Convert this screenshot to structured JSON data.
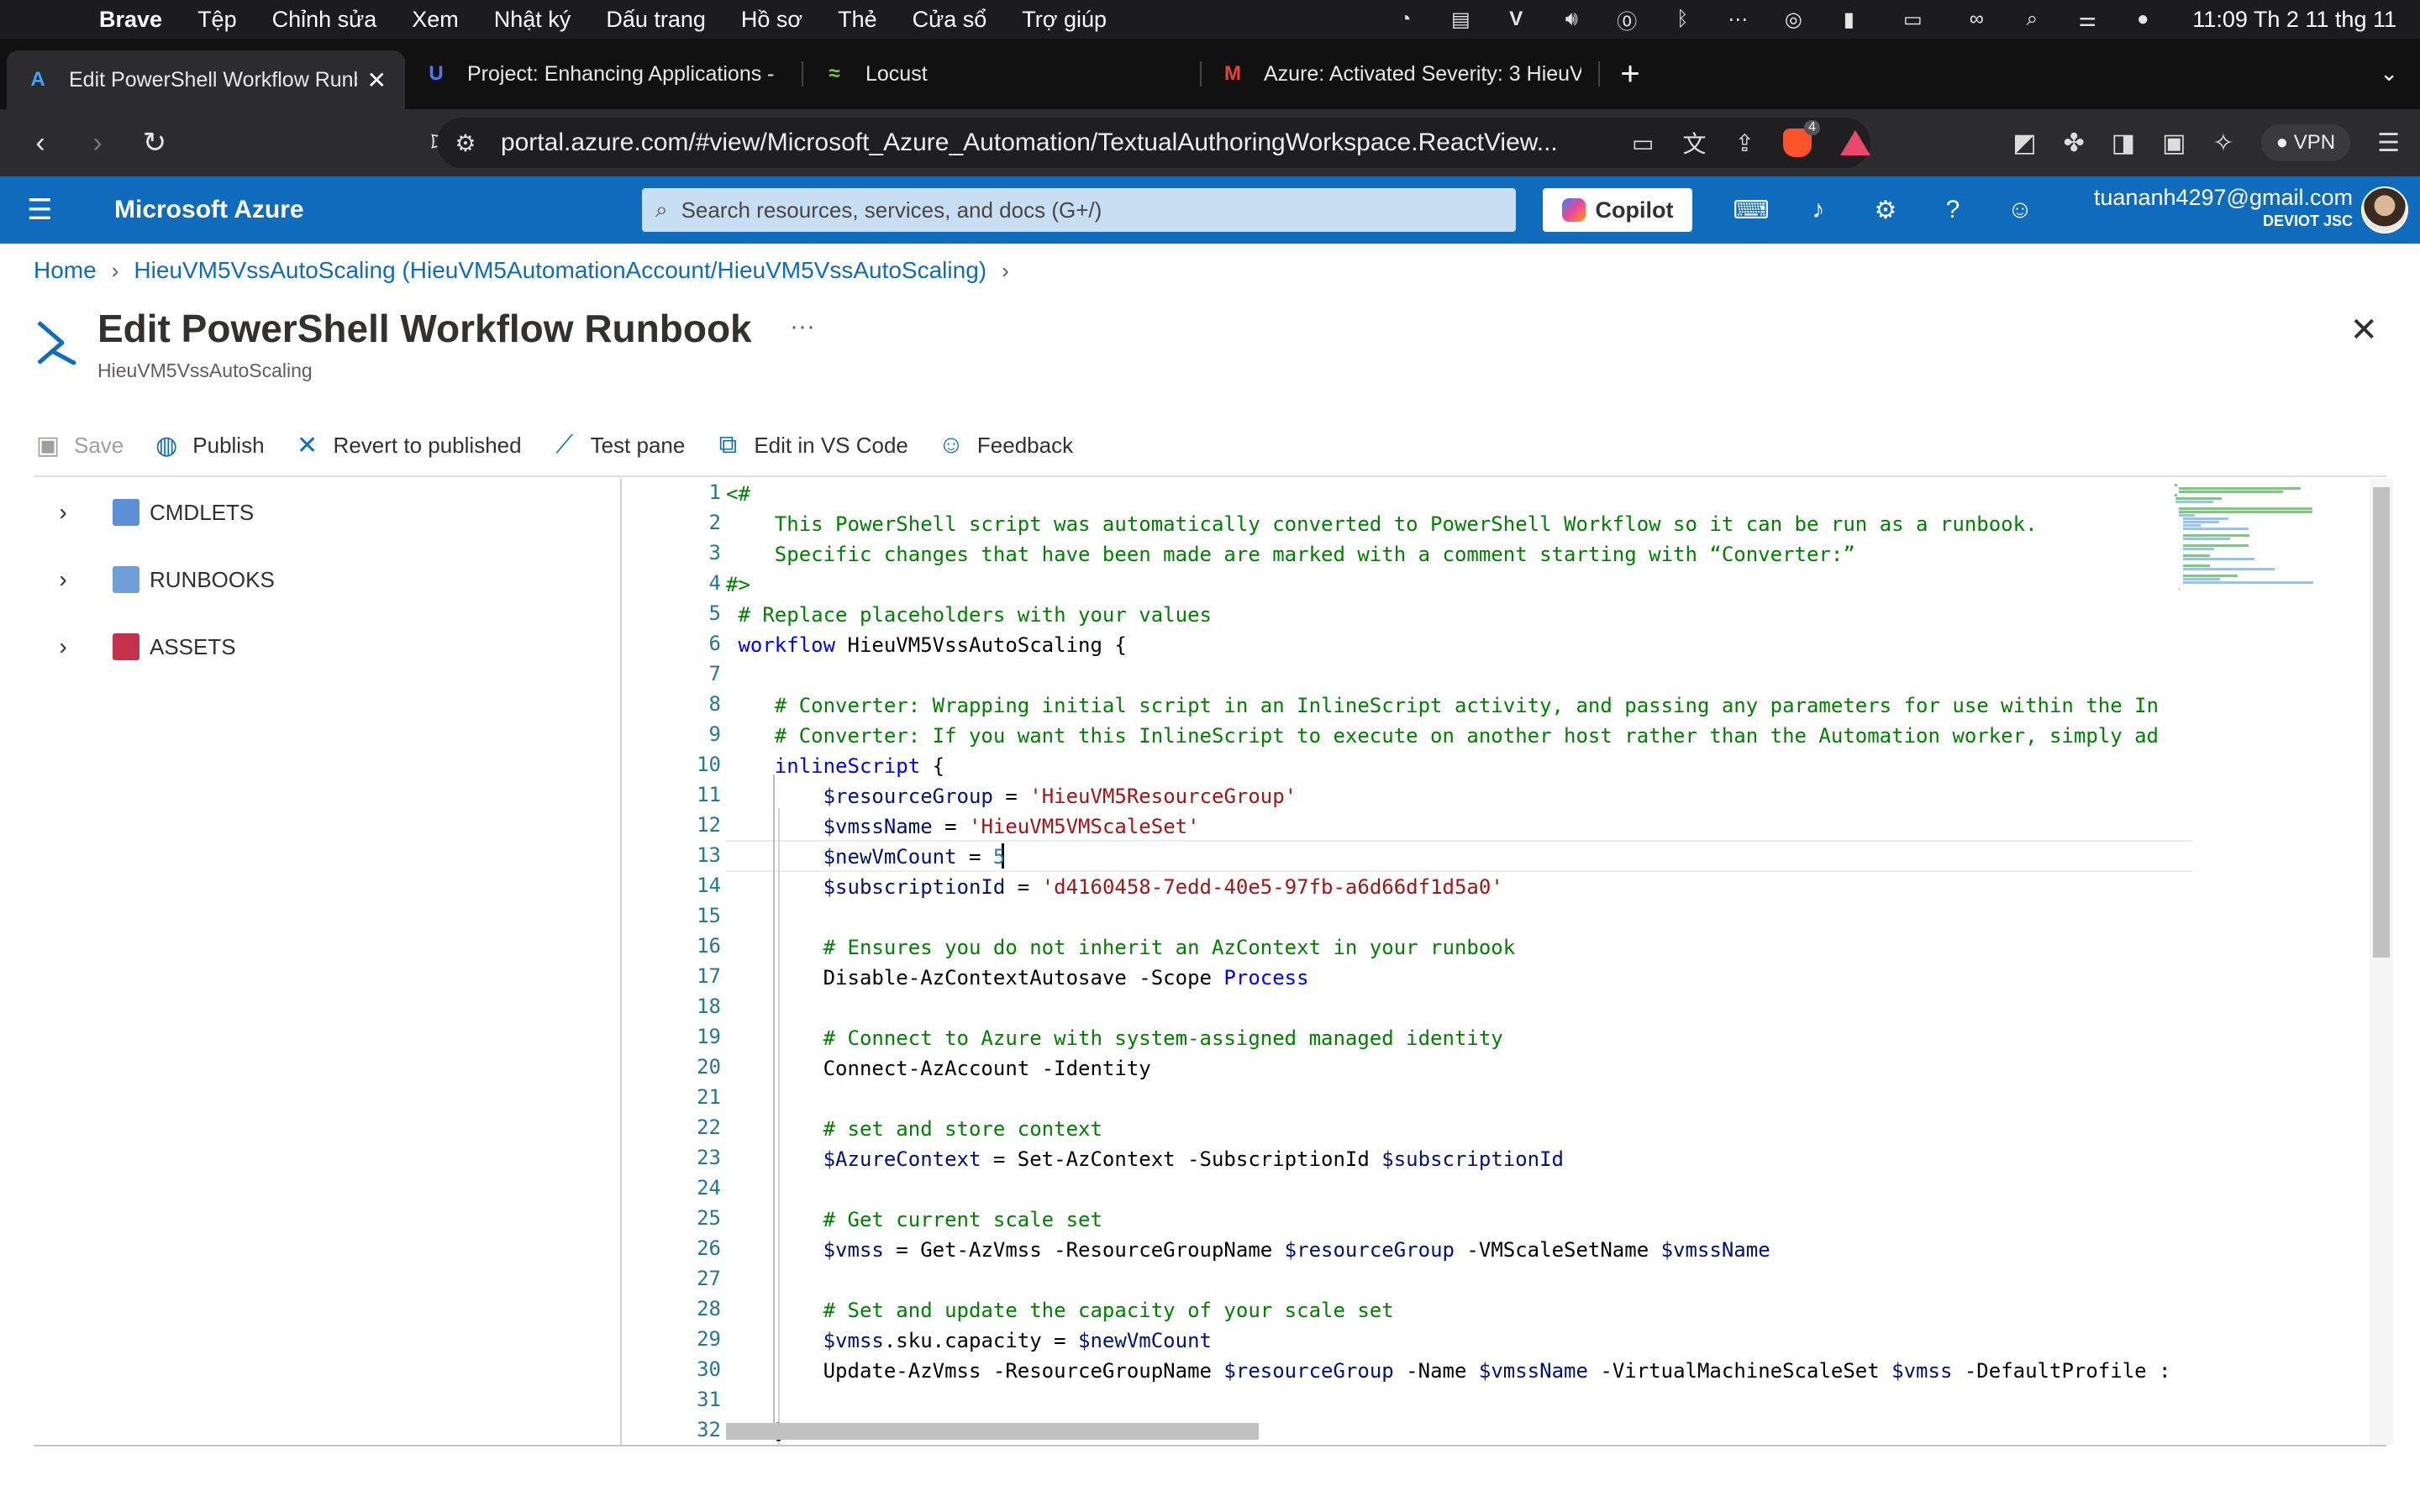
{
  "menubar": {
    "app": "Brave",
    "items": [
      "Tệp",
      "Chỉnh sửa",
      "Xem",
      "Nhật ký",
      "Dấu trang",
      "Hồ sơ",
      "Thẻ",
      "Cửa sổ",
      "Trợ giúp"
    ],
    "clock": "11:09 Th 2 11 thg 11",
    "status_icons": [
      "timer-icon",
      "keyboard-icon",
      "v-icon",
      "volume-icon",
      "accessibility-icon",
      "bluetooth-icon",
      "network-icon",
      "airdrop-icon",
      "battery-status-icon",
      "battery-icon",
      "link-icon",
      "search-icon",
      "control-center-icon",
      "siri-icon"
    ]
  },
  "tabs": [
    {
      "title": "Edit PowerShell Workflow Runbook",
      "icon": "azure-icon",
      "active": true
    },
    {
      "title": "Project: Enhancing Applications -",
      "icon": "udacity-icon",
      "active": false
    },
    {
      "title": "Locust",
      "icon": "locust-icon",
      "active": false
    },
    {
      "title": "Azure: Activated Severity: 3 HieuV",
      "icon": "gmail-icon",
      "active": false
    }
  ],
  "newtab_label": "+",
  "tablist_label": "⌄",
  "addressbar": {
    "url": "portal.azure.com/#view/Microsoft_Azure_Automation/TextualAuthoringWorkspace.ReactView...",
    "brave_badge_count": "4",
    "vpn_label": "VPN"
  },
  "azure": {
    "brand": "Microsoft Azure",
    "search_placeholder": "Search resources, services, and docs (G+/)",
    "copilot_label": "Copilot",
    "account_email": "tuananh4297@gmail.com",
    "account_org": "DEVIOT JSC"
  },
  "breadcrumb": {
    "home": "Home",
    "item": "HieuVM5VssAutoScaling (HieuVM5AutomationAccount/HieuVM5VssAutoScaling)"
  },
  "page": {
    "title": "Edit PowerShell Workflow Runbook",
    "more": "···",
    "subtitle": "HieuVM5VssAutoScaling"
  },
  "commands": {
    "save": "Save",
    "publish": "Publish",
    "revert": "Revert to published",
    "test": "Test pane",
    "vscode": "Edit in VS Code",
    "feedback": "Feedback"
  },
  "tree": {
    "cmdlets": "CMDLETS",
    "runbooks": "RUNBOOKS",
    "assets": "ASSETS"
  },
  "editor": {
    "current_line": 13,
    "lines": [
      "<#",
      "    This PowerShell script was automatically converted to PowerShell Workflow so it can be run as a runbook.",
      "    Specific changes that have been made are marked with a comment starting with “Converter:”",
      "#>",
      " # Replace placeholders with your values",
      " workflow HieuVM5VssAutoScaling {",
      "",
      "    # Converter: Wrapping initial script in an InlineScript activity, and passing any parameters for use within the In",
      "    # Converter: If you want this InlineScript to execute on another host rather than the Automation worker, simply ad",
      "    inlineScript {",
      "        $resourceGroup = 'HieuVM5ResourceGroup'",
      "        $vmssName = 'HieuVM5VMScaleSet'",
      "        $newVmCount = 5",
      "        $subscriptionId = 'd4160458-7edd-40e5-97fb-a6d66df1d5a0'",
      "",
      "        # Ensures you do not inherit an AzContext in your runbook",
      "        Disable-AzContextAutosave -Scope Process",
      "",
      "        # Connect to Azure with system-assigned managed identity",
      "        Connect-AzAccount -Identity",
      "",
      "        # set and store context",
      "        $AzureContext = Set-AzContext -SubscriptionId $subscriptionId",
      "",
      "        # Get current scale set",
      "        $vmss = Get-AzVmss -ResourceGroupName $resourceGroup -VMScaleSetName $vmssName",
      "",
      "        # Set and update the capacity of your scale set",
      "        $vmss.sku.capacity = $newVmCount",
      "        Update-AzVmss -ResourceGroupName $resourceGroup -Name $vmssName -VirtualMachineScaleSet $vmss -DefaultProfile :",
      "",
      "    }"
    ]
  }
}
